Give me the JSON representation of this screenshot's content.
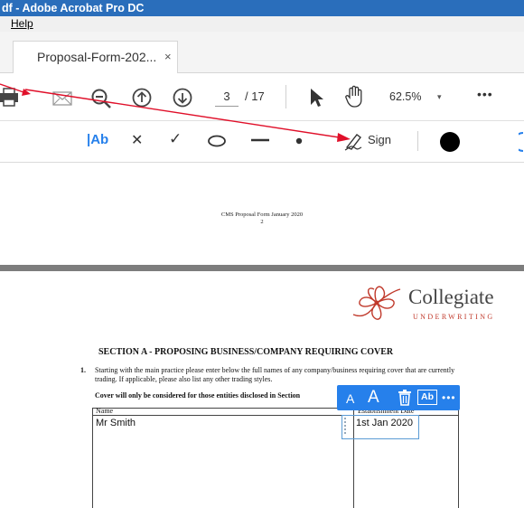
{
  "window": {
    "title": "df - Adobe Acrobat Pro DC"
  },
  "menu": {
    "help": "Help"
  },
  "tab": {
    "label": "Proposal-Form-202...",
    "close": "×"
  },
  "toolbar": {
    "current_page": "3",
    "total_pages": "/ 17",
    "zoom": "62.5%",
    "zoom_dropdown": "▾",
    "more": "•••"
  },
  "fill_sign": {
    "text_tool": "|Ab",
    "cross": "✕",
    "check": "✓",
    "sign_label": "Sign"
  },
  "document": {
    "footer_line1": "CMS Proposal Form January 2020",
    "footer_line2": "2",
    "logo_name": "Collegiate",
    "logo_sub": "UNDERWRITING",
    "section_title": "SECTION A - PROPOSING BUSINESS/COMPANY REQUIRING COVER",
    "item_number": "1.",
    "paragraph": "Starting with the main practice please enter below the full names of any company/business requiring cover that are currently trading. If applicable, please also list any other trading styles.",
    "cover_note": "Cover will only be considered for those entities disclosed in Section",
    "table": {
      "headers": [
        "Name",
        "Establishment Date"
      ],
      "rows": [
        [
          "Mr Smith",
          "1st Jan 2020"
        ]
      ]
    }
  },
  "mini_toolbar": {
    "smaller": "A",
    "larger": "A",
    "field_label": "Ab",
    "more": "•••"
  },
  "colors": {
    "acrobat_blue": "#2a6ebb",
    "accent": "#2680eb",
    "annotation_red": "#e0102a",
    "logo_red": "#c0392b"
  }
}
